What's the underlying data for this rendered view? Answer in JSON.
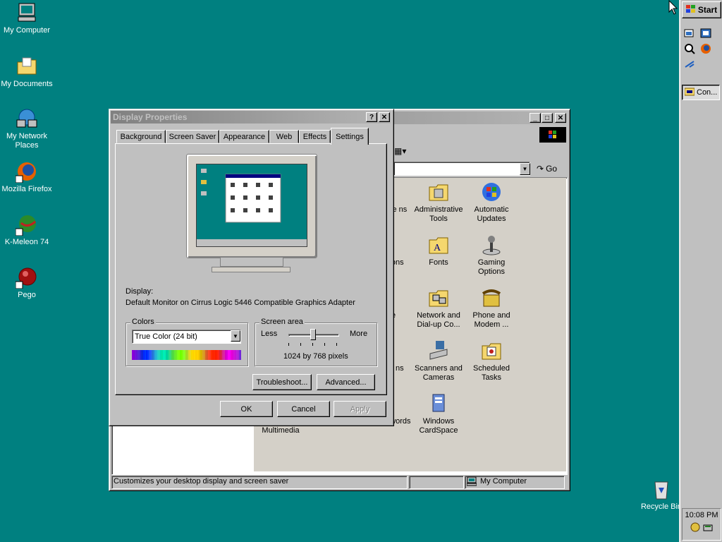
{
  "desktop": {
    "icons": [
      {
        "label": "My Computer"
      },
      {
        "label": "My Documents"
      },
      {
        "label": "My Network Places"
      },
      {
        "label": "Mozilla Firefox"
      },
      {
        "label": "K-Meleon 74"
      },
      {
        "label": "Pego"
      },
      {
        "label": "Recycle Bin"
      }
    ]
  },
  "taskbar": {
    "start_label": "Start",
    "task_label": "Con...",
    "clock": "10:08 PM"
  },
  "control_panel": {
    "go_label": "Go",
    "status_left": "Customizes your desktop display and screen saver",
    "status_right": "My Computer",
    "items": [
      {
        "label": "Administrative Tools"
      },
      {
        "label": "Automatic Updates"
      },
      {
        "label": "Fonts"
      },
      {
        "label": "Gaming Options"
      },
      {
        "label": "Network and Dial-up Co..."
      },
      {
        "label": "Phone and Modem ..."
      },
      {
        "label": "Scanners and Cameras"
      },
      {
        "label": "Scheduled Tasks"
      },
      {
        "label": "Windows CardSpace"
      },
      {
        "label": "Multimedia"
      },
      {
        "label": "nd Passwords"
      },
      {
        "label": "nove ns"
      },
      {
        "label": "ptions"
      },
      {
        "label": "e"
      },
      {
        "label": "nal ns"
      }
    ]
  },
  "dialog": {
    "title": "Display Properties",
    "tabs": [
      "Background",
      "Screen Saver",
      "Appearance",
      "Web",
      "Effects",
      "Settings"
    ],
    "display_label": "Display:",
    "display_value": "Default Monitor on Cirrus Logic 5446 Compatible Graphics Adapter",
    "colors_group": "Colors",
    "colors_value": "True Color (24 bit)",
    "screen_area_group": "Screen area",
    "less_label": "Less",
    "more_label": "More",
    "resolution": "1024 by 768 pixels",
    "troubleshoot_label": "Troubleshoot...",
    "advanced_label": "Advanced...",
    "ok_label": "OK",
    "cancel_label": "Cancel",
    "apply_label": "Apply"
  }
}
